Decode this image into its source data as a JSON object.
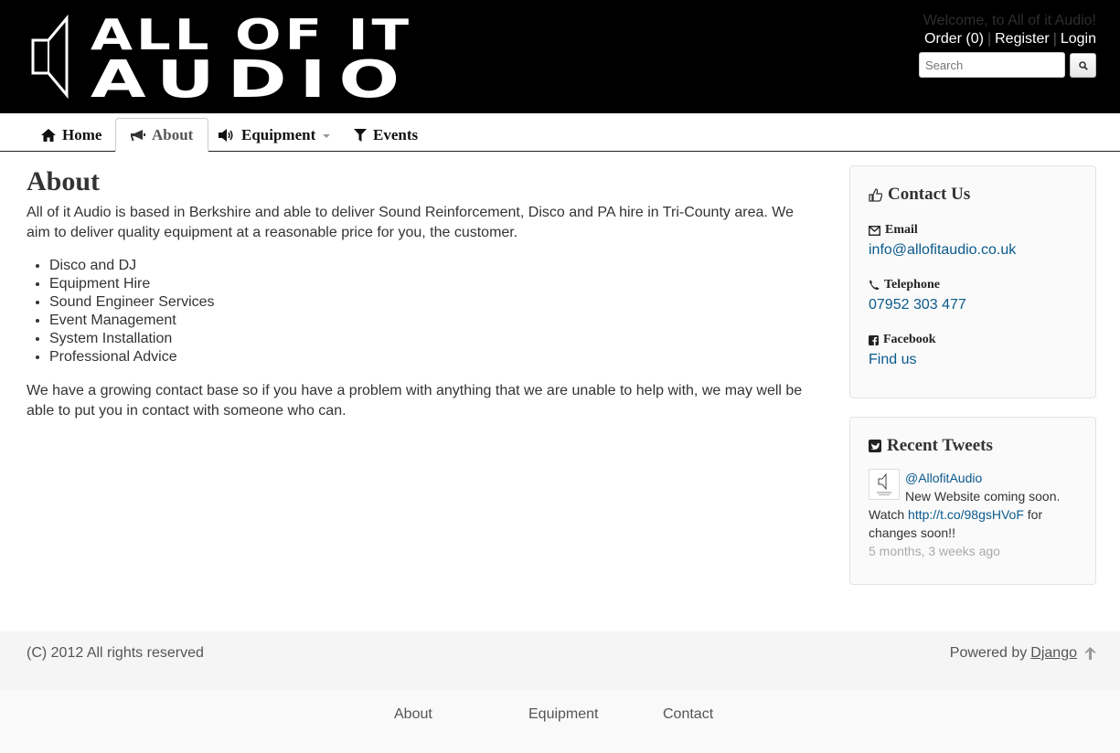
{
  "header": {
    "logo_line1": "ALL OF IT",
    "logo_line2": "AUDIO",
    "welcome": "Welcome, to All of it Audio!",
    "order_link": "Order (0)",
    "register_link": "Register",
    "login_link": "Login",
    "separator": "|",
    "search_placeholder": "Search"
  },
  "nav": {
    "items": [
      {
        "label": "Home",
        "icon": "home-icon"
      },
      {
        "label": "About",
        "icon": "bullhorn-icon",
        "active": true
      },
      {
        "label": "Equipment",
        "icon": "volume-icon",
        "dropdown": true
      },
      {
        "label": "Events",
        "icon": "filter-icon"
      }
    ]
  },
  "main": {
    "title": "About",
    "intro": "All of it Audio is based in Berkshire and able to deliver Sound Reinforcement, Disco and PA hire in Tri-County area. We aim to deliver quality equipment at a reasonable price for you, the customer.",
    "services": [
      "Disco and DJ",
      "Equipment Hire",
      "Sound Engineer Services",
      "Event Management",
      "System Installation",
      "Professional Advice"
    ],
    "outro": "We have a growing contact base so if you have a problem with anything that we are unable to help with, we may well be able to put you in contact with someone who can."
  },
  "contact": {
    "title": "Contact Us",
    "email_label": "Email",
    "email_value": "info@allofitaudio.co.uk",
    "telephone_label": "Telephone",
    "telephone_value": "07952 303 477",
    "facebook_label": "Facebook",
    "facebook_value": "Find us"
  },
  "tweets": {
    "title": "Recent Tweets",
    "handle": "@AllofitAudio",
    "text_before": "New Website coming soon. Watch ",
    "link": "http://t.co/98gsHVoF",
    "text_after": " for changes soon!!",
    "time": "5 months, 3 weeks ago"
  },
  "footer": {
    "copyright": "(C) 2012 All rights reserved",
    "powered_by": "Powered by",
    "django_link": "Django"
  },
  "bottom_links": [
    "About",
    "Equipment",
    "Contact"
  ],
  "colors": {
    "header_bg": "#000000",
    "link": "#0a5a8c",
    "panel_bg": "#fafafa"
  }
}
